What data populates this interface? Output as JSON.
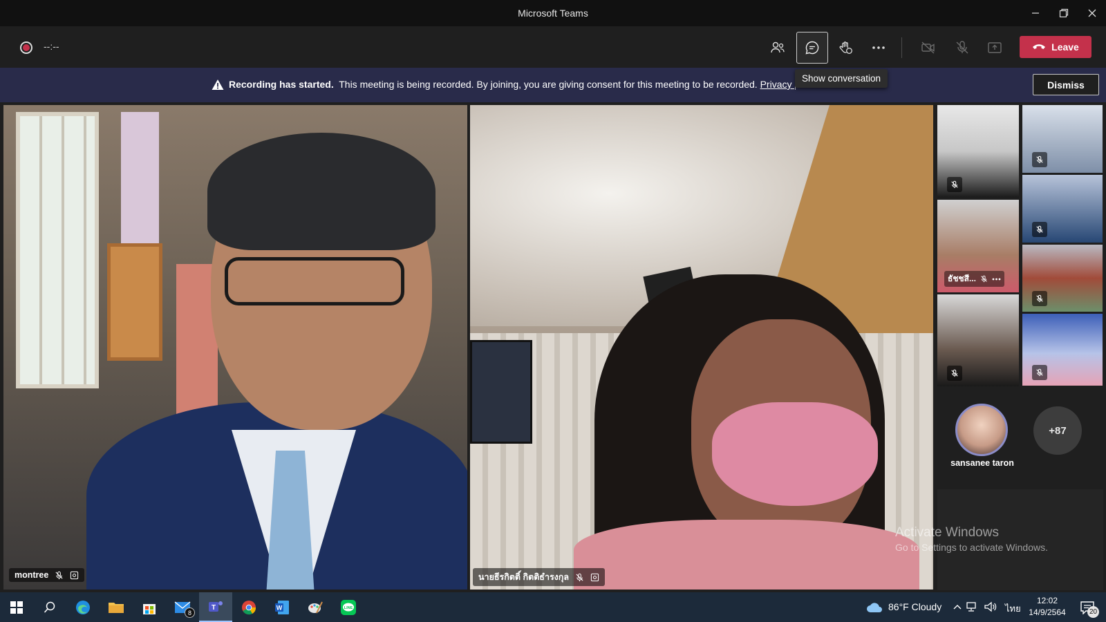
{
  "window": {
    "title": "Microsoft Teams"
  },
  "toolbar": {
    "timer": "--:--",
    "tooltip": "Show conversation",
    "leave_label": "Leave"
  },
  "banner": {
    "bold": "Recording has started.",
    "text": "This meeting is being recorded. By joining, you are giving consent for this meeting to be recorded.",
    "link": "Privacy p",
    "dismiss_label": "Dismiss"
  },
  "stage": {
    "participants": [
      {
        "name": "montree"
      },
      {
        "name": "นายธีรกิตติ์ กิตติธำรงกุล"
      }
    ],
    "thumbnails": [
      {
        "name": "ธัชชสี..."
      }
    ],
    "avatar_name": "sansanee taron",
    "overflow_count": "+87"
  },
  "watermark": {
    "line1": "Activate Windows",
    "line2": "Go to Settings to activate Windows."
  },
  "taskbar": {
    "mail_badge": "8",
    "weather": "86°F  Cloudy",
    "lang": "ไทย",
    "time": "12:02",
    "date": "14/9/2564",
    "notif_count": "20"
  },
  "colors": {
    "leave": "#c4314b",
    "banner": "#292b4a",
    "taskbar": "#1c2a3a"
  }
}
